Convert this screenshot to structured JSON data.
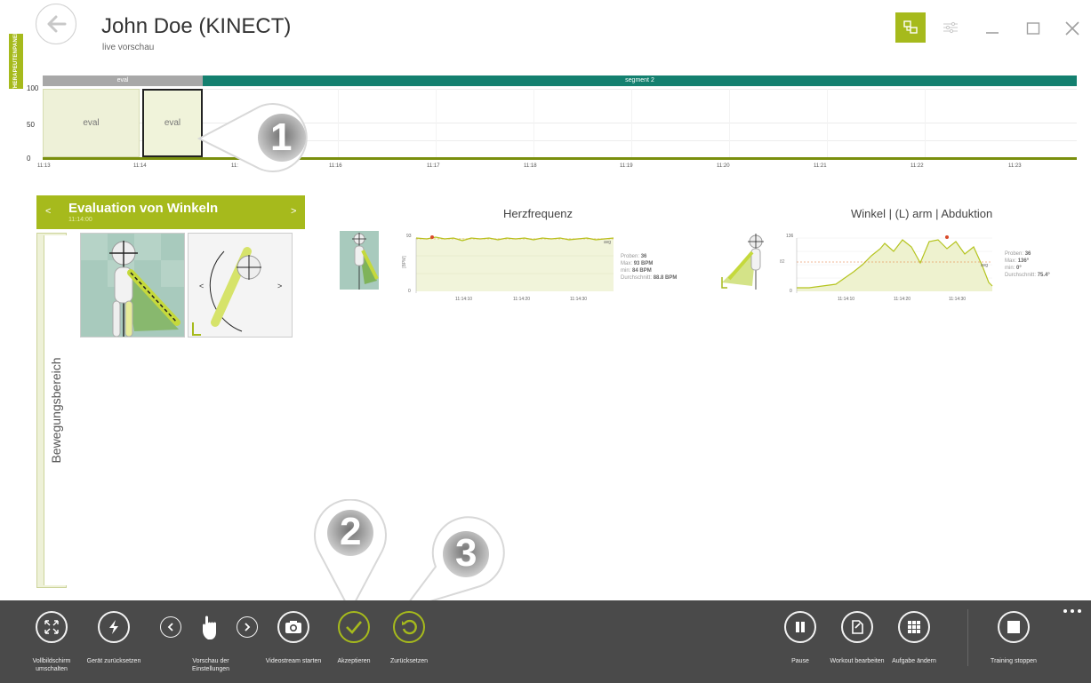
{
  "header": {
    "title": "John Doe (KINECT)",
    "subtitle": "live vorschau"
  },
  "therapist_panel_label": "THERAPEUTENPANEL",
  "timeline": {
    "segments": [
      "eval",
      "segment 2"
    ],
    "y_labels": [
      "100",
      "50",
      "0"
    ],
    "blocks": [
      "eval",
      "eval"
    ],
    "x_ticks": [
      "11:13",
      "11:14",
      "11:",
      "11:16",
      "11:17",
      "11:18",
      "11:19",
      "11:20",
      "11:21",
      "11:22",
      "11:23"
    ]
  },
  "callouts": [
    "1",
    "2",
    "3"
  ],
  "evaluation": {
    "title": "Evaluation von Winkeln",
    "time": "11:14:00",
    "prev": "<",
    "next": ">",
    "category": "Bewegungsbereich",
    "thumb_prev": "<",
    "thumb_next": ">"
  },
  "heart_rate": {
    "title": "Herzfrequenz",
    "y_top": "93",
    "y_bottom": "0",
    "axis": "[BPM]",
    "avg_label": "avg",
    "x_ticks": [
      "11:14:10",
      "11:14:20",
      "11:14:30"
    ],
    "stats": {
      "samples_label": "Proben:",
      "samples": "36",
      "max_label": "Max:",
      "max": "93 BPM",
      "min_label": "min:",
      "min": "84 BPM",
      "avg_label": "Durchschnitt:",
      "avg": "88.8 BPM"
    }
  },
  "angle": {
    "title": "Winkel | (L) arm | Abduktion",
    "y_top": "136",
    "y_mid": "82",
    "y_bottom": "0",
    "avg_label": "avg",
    "x_ticks": [
      "11:14:10",
      "11:14:20",
      "11:14:30"
    ],
    "stats": {
      "samples_label": "Proben:",
      "samples": "36",
      "max_label": "Max:",
      "max": "136°",
      "min_label": "min:",
      "min": "0°",
      "avg_label": "Durchschnitt:",
      "avg": "75.4°"
    }
  },
  "toolbar": {
    "fullscreen": "Vollbildschirm umschalten",
    "reset_device": "Gerät zurücksetzen",
    "settings_preview": "Vorschau der Einstellungen",
    "videostream": "Videostream starten",
    "accept": "Akzeptieren",
    "reset": "Zurücksetzen",
    "pause": "Pause",
    "edit_workout": "Workout bearbeiten",
    "change_task": "Aufgabe ändern",
    "stop_training": "Training stoppen"
  },
  "colors": {
    "accent": "#a6ba1c",
    "segment2": "#14806f",
    "toolbar": "#4a4a4a"
  }
}
